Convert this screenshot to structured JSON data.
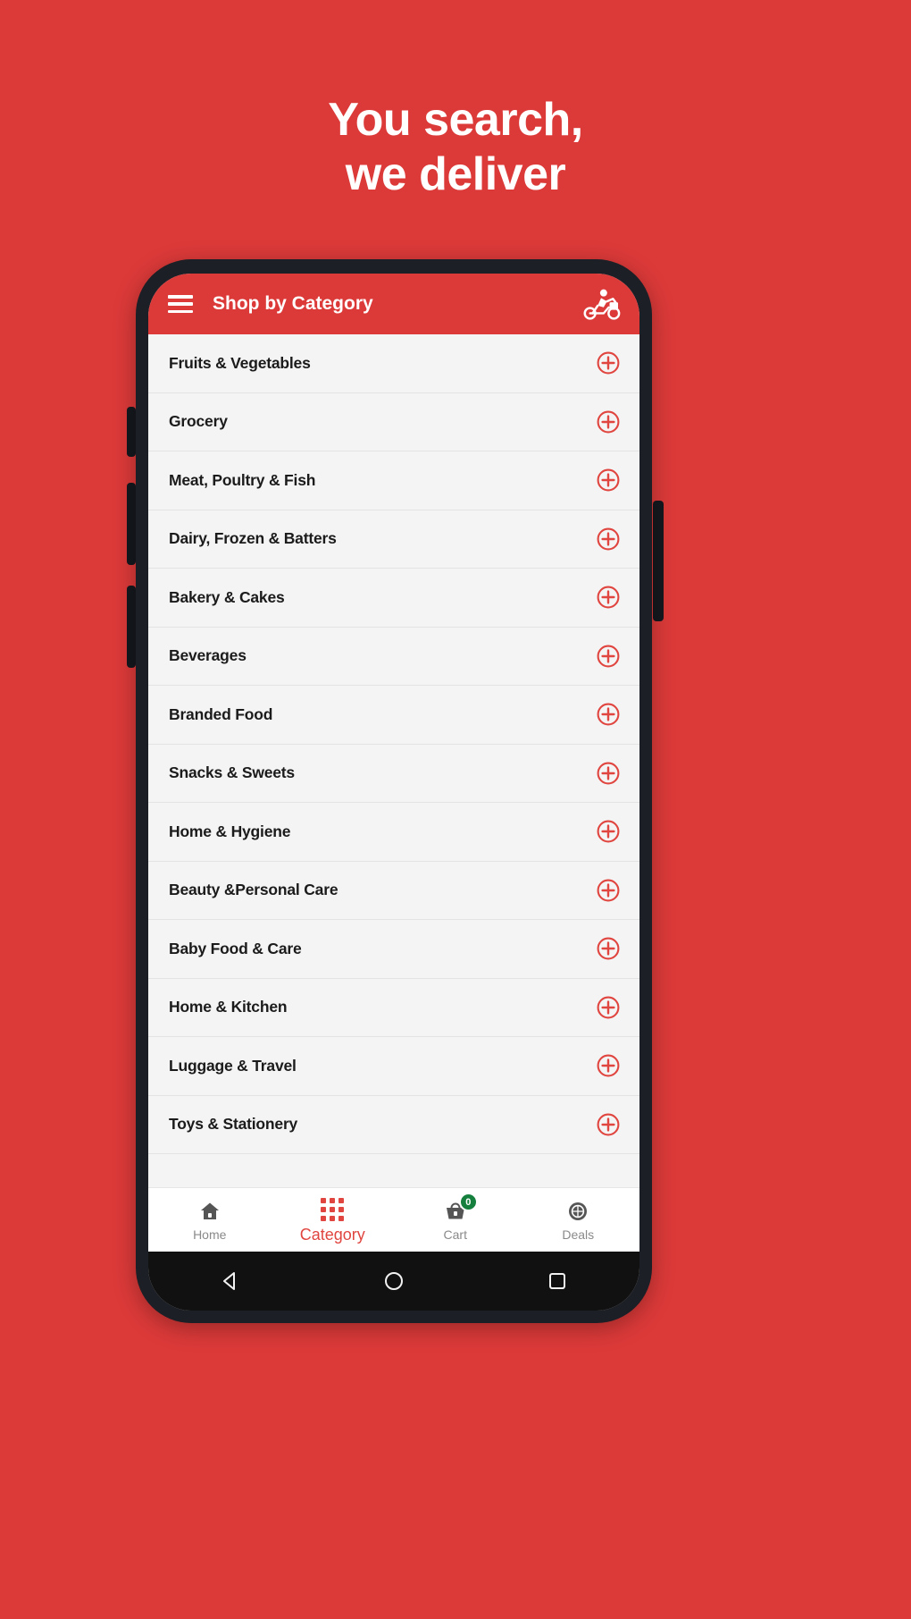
{
  "banner": {
    "background_color": "#DC3A39",
    "headline_line1": "You search,",
    "headline_line2": "we deliver"
  },
  "app": {
    "appbar": {
      "menu_icon": "hamburger-menu-icon",
      "title": "Shop by Category",
      "action_icon": "delivery-scooter-icon",
      "background_color": "#DC3A39",
      "title_color": "#FFFFFF"
    },
    "categories": [
      {
        "label": "Fruits & Vegetables",
        "action_icon": "plus-circle-icon"
      },
      {
        "label": "Grocery",
        "action_icon": "plus-circle-icon"
      },
      {
        "label": "Meat, Poultry & Fish",
        "action_icon": "plus-circle-icon"
      },
      {
        "label": "Dairy, Frozen & Batters",
        "action_icon": "plus-circle-icon"
      },
      {
        "label": "Bakery & Cakes",
        "action_icon": "plus-circle-icon"
      },
      {
        "label": "Beverages",
        "action_icon": "plus-circle-icon"
      },
      {
        "label": "Branded Food",
        "action_icon": "plus-circle-icon"
      },
      {
        "label": "Snacks & Sweets",
        "action_icon": "plus-circle-icon"
      },
      {
        "label": "Home & Hygiene",
        "action_icon": "plus-circle-icon"
      },
      {
        "label": "Beauty &Personal Care",
        "action_icon": "plus-circle-icon"
      },
      {
        "label": "Baby Food & Care",
        "action_icon": "plus-circle-icon"
      },
      {
        "label": "Home & Kitchen",
        "action_icon": "plus-circle-icon"
      },
      {
        "label": "Luggage & Travel",
        "action_icon": "plus-circle-icon"
      },
      {
        "label": "Toys & Stationery",
        "action_icon": "plus-circle-icon"
      }
    ],
    "bottom_nav": {
      "items": [
        {
          "label": "Home",
          "icon": "home-icon",
          "active": false
        },
        {
          "label": "Category",
          "icon": "grid-icon",
          "active": true
        },
        {
          "label": "Cart",
          "icon": "cart-icon",
          "active": false,
          "badge": "0"
        },
        {
          "label": "Deals",
          "icon": "deals-tag-icon",
          "active": false
        }
      ],
      "active_color": "#E0453F",
      "inactive_color": "#8A8A8A",
      "badge_color": "#15803D"
    },
    "android_nav": {
      "back": "back-triangle-icon",
      "home": "home-circle-icon",
      "recents": "recents-square-icon"
    }
  }
}
